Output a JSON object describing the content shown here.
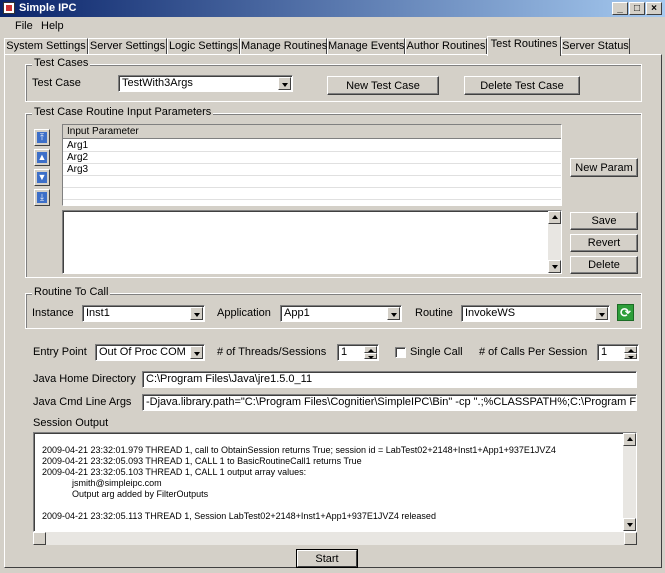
{
  "window": {
    "title": "Simple IPC"
  },
  "menu": [
    "File",
    "Help"
  ],
  "tabs": [
    "System Settings",
    "Server Settings",
    "Logic Settings",
    "Manage Routines",
    "Manage Events",
    "Author Routines",
    "Test Routines",
    "Server Status"
  ],
  "active_tab": "Test Routines",
  "test_cases": {
    "group_label": "Test Cases",
    "label": "Test Case",
    "selected": "TestWith3Args",
    "new_button": "New Test Case",
    "delete_button": "Delete Test Case"
  },
  "input_params": {
    "group_label": "Test Case Routine Input Parameters",
    "column_header": "Input Parameter",
    "rows": [
      "Arg1",
      "Arg2",
      "Arg3"
    ],
    "new_param_button": "New Param",
    "save_button": "Save",
    "revert_button": "Revert",
    "delete_button": "Delete",
    "move_icons": [
      "move-top-icon",
      "move-up-icon",
      "move-down-icon",
      "move-bottom-icon"
    ]
  },
  "routine_to_call": {
    "group_label": "Routine To Call",
    "instance_label": "Instance",
    "instance_value": "Inst1",
    "application_label": "Application",
    "application_value": "App1",
    "routine_label": "Routine",
    "routine_value": "InvokeWS"
  },
  "execution": {
    "entry_point_label": "Entry Point",
    "entry_point_value": "Out Of Proc COM",
    "threads_label": "# of Threads/Sessions",
    "threads_value": "1",
    "single_call_label": "Single Call",
    "calls_label": "# of Calls Per Session",
    "calls_value": "1",
    "java_home_label": "Java Home Directory",
    "java_home_value": "C:\\Program Files\\Java\\jre1.5.0_11",
    "java_cmd_label": "Java Cmd Line Args",
    "java_cmd_value": "-Djava.library.path=\"C:\\Program Files\\Cognitier\\SimpleIPC\\Bin\" -cp \".;%CLASSPATH%;C:\\Program Files\\Cog"
  },
  "session_output": {
    "label": "Session Output",
    "lines": [
      "2009-04-21 23:32:01.979 THREAD 1, call to ObtainSession returns True; session id = LabTest02+2148+Inst1+App1+937E1JVZ4",
      "2009-04-21 23:32:05.093 THREAD 1, CALL 1 to BasicRoutineCall1 returns True",
      "2009-04-21 23:32:05.103 THREAD 1, CALL 1 output array values:",
      "jsmith@simpleipc.com",
      "Output arg added by FilterOutputs",
      "",
      "2009-04-21 23:32:05.113 THREAD 1, Session LabTest02+2148+Inst1+App1+937E1JVZ4 released"
    ]
  },
  "start_button": "Start",
  "colors": {
    "title_start": "#0a246a",
    "title_end": "#a6caf0",
    "face": "#d4d0c8",
    "arrow_blue": "#3d6fc8",
    "refresh_green": "#2e9e3a"
  }
}
